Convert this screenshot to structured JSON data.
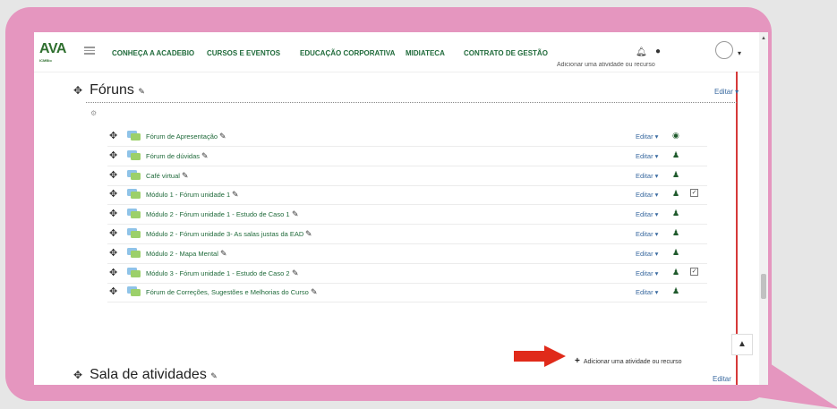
{
  "colors": {
    "bubble": "#e596bf",
    "brand_green": "#1f6a3a",
    "edit_link": "#3a6aa0",
    "arrow_red": "#e02a1a",
    "section_border": "#d63a3a"
  },
  "header": {
    "logo_text": "AVA",
    "logo_sub": "ICMBio",
    "menu_icon": "hamburger-icon",
    "nav": [
      "CONHEÇA A ACADEBIO",
      "CURSOS E EVENTOS",
      "EDUCAÇÃO CORPORATIVA",
      "MIDIATECA",
      "CONTRATO DE GESTÃO"
    ],
    "notifications_icon": "bell-icon",
    "messages_icon": "chat-icon",
    "user_icon": "avatar-icon"
  },
  "cut_add_text": "Adicionar uma atividade ou recurso",
  "sections": [
    {
      "title": "Fóruns",
      "edit": "Editar"
    },
    {
      "title": "Sala de atividades",
      "edit": "Editar"
    }
  ],
  "activities": [
    {
      "name": "Fórum de Apresentação",
      "edit": "Editar",
      "perm": "◉",
      "check": ""
    },
    {
      "name": "Fórum de dúvidas",
      "edit": "Editar",
      "perm": "♟",
      "check": ""
    },
    {
      "name": "Café virtual",
      "edit": "Editar",
      "perm": "♟",
      "check": ""
    },
    {
      "name": "Módulo 1 - Fórum unidade 1",
      "edit": "Editar",
      "perm": "♟",
      "check": "✓"
    },
    {
      "name": "Módulo 2 - Fórum unidade 1 - Estudo de Caso 1",
      "edit": "Editar",
      "perm": "♟",
      "check": ""
    },
    {
      "name": "Módulo 2 - Fórum unidade 3- As salas justas da EAD",
      "edit": "Editar",
      "perm": "♟",
      "check": ""
    },
    {
      "name": "Módulo 2 - Mapa Mental",
      "edit": "Editar",
      "perm": "♟",
      "check": ""
    },
    {
      "name": "Módulo 3 - Fórum unidade 1 - Estudo de Caso 2",
      "edit": "Editar",
      "perm": "♟",
      "check": "✓"
    },
    {
      "name": "Fórum de Correções, Sugestões e Melhorias do Curso",
      "edit": "Editar",
      "perm": "♟",
      "check": ""
    }
  ],
  "add_activity_label": "Adicionar uma atividade ou recurso",
  "back_to_top_icon": "arrow-up-icon"
}
